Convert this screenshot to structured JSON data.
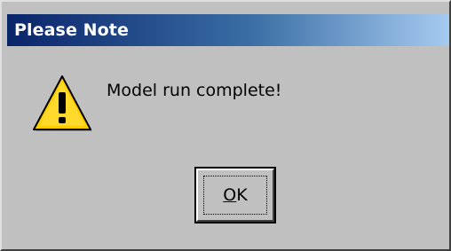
{
  "window": {
    "title": "Please Note"
  },
  "dialog": {
    "icon": "warning-icon",
    "message": "Model run complete!"
  },
  "buttons": {
    "ok_mnemonic": "O",
    "ok_rest": "K"
  },
  "colors": {
    "titlebar_start": "#0a246a",
    "titlebar_end": "#a6caf0",
    "dialog_face": "#c0c0c0",
    "warning_fill": "#ffcc00"
  }
}
